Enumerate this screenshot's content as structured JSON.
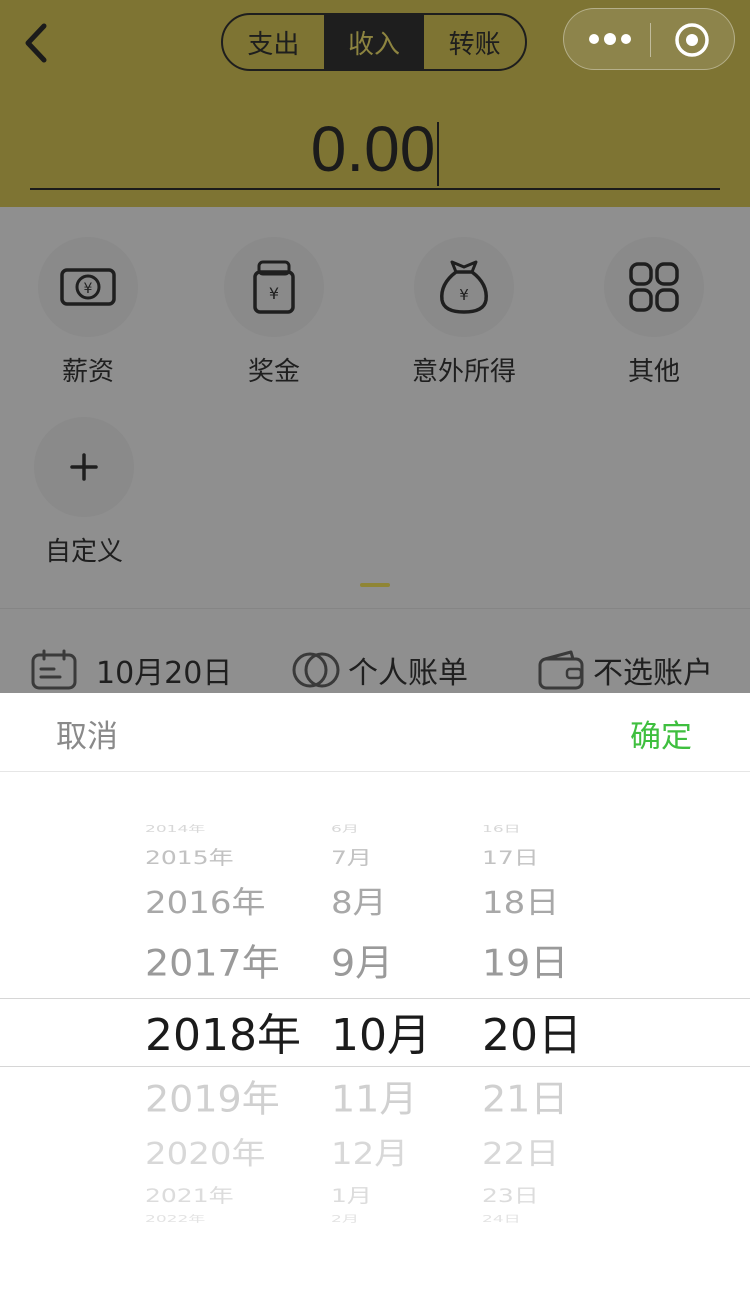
{
  "header": {
    "tabs": [
      {
        "label": "支出",
        "active": false
      },
      {
        "label": "收入",
        "active": true
      },
      {
        "label": "转账",
        "active": false
      }
    ],
    "amount": "0.00"
  },
  "categories": [
    {
      "label": "薪资",
      "icon": "salary-icon"
    },
    {
      "label": "奖金",
      "icon": "bonus-icon"
    },
    {
      "label": "意外所得",
      "icon": "windfall-bag-icon"
    },
    {
      "label": "其他",
      "icon": "grid-icon"
    },
    {
      "label": "自定义",
      "icon": "plus-icon"
    }
  ],
  "meta": {
    "date": "10月20日",
    "bill": "个人账单",
    "account": "不选账户"
  },
  "picker": {
    "cancel_label": "取消",
    "confirm_label": "确定",
    "years": [
      "2014年",
      "2015年",
      "2016年",
      "2017年",
      "2018年",
      "2019年",
      "2020年",
      "2021年",
      "2022年"
    ],
    "months": [
      "6月",
      "7月",
      "8月",
      "9月",
      "10月",
      "11月",
      "12月",
      "1月",
      "2月"
    ],
    "days": [
      "16日",
      "17日",
      "18日",
      "19日",
      "20日",
      "21日",
      "22日",
      "23日",
      "24日"
    ],
    "selected": {
      "year": "2018年",
      "month": "10月",
      "day": "20日"
    }
  },
  "colors": {
    "header_bg": "#7e7433",
    "confirm": "#3fbf3f",
    "indicator": "#8f8535"
  }
}
